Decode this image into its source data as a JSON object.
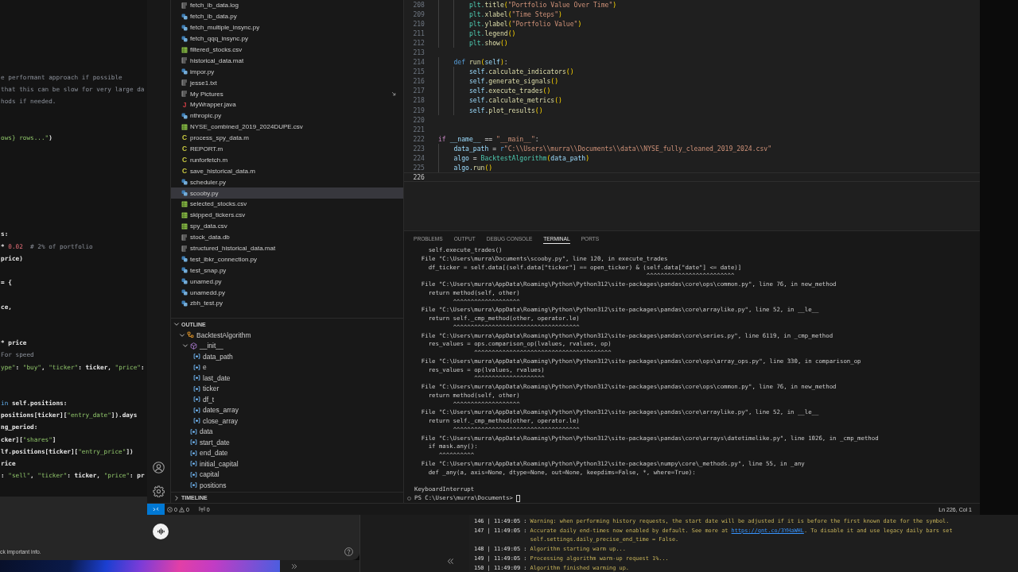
{
  "left_window": {
    "lines": [
      {
        "kind": "code",
        "tokens": [
          {
            "kind": "comment",
            "text": "e performant approach if possible"
          }
        ]
      },
      {
        "kind": "code",
        "tokens": [
          {
            "kind": "comment",
            "text": "that this can be slow for very large da"
          }
        ]
      },
      {
        "kind": "code",
        "tokens": [
          {
            "kind": "comment",
            "text": "hods if needed."
          }
        ]
      },
      {
        "kind": "blank"
      },
      {
        "kind": "blank"
      },
      {
        "kind": "code",
        "tokens": [
          {
            "kind": "string",
            "text": "ows} rows...\""
          },
          {
            "kind": "plain",
            "text": ")"
          }
        ]
      },
      {
        "kind": "blank"
      },
      {
        "kind": "blank"
      },
      {
        "kind": "blank"
      },
      {
        "kind": "blank"
      },
      {
        "kind": "blank"
      },
      {
        "kind": "blank"
      },
      {
        "kind": "blank"
      },
      {
        "kind": "code",
        "tokens": [
          {
            "kind": "plain",
            "text": "s:"
          }
        ]
      },
      {
        "kind": "code",
        "tokens": [
          {
            "kind": "plain",
            "text": "* "
          },
          {
            "kind": "number",
            "text": "0.02"
          },
          {
            "kind": "comment",
            "text": "  # 2% of portfolio"
          }
        ]
      },
      {
        "kind": "code",
        "tokens": [
          {
            "kind": "plain",
            "text": "price)"
          }
        ]
      },
      {
        "kind": "blank"
      },
      {
        "kind": "code",
        "tokens": [
          {
            "kind": "plain",
            "text": "= {"
          }
        ]
      },
      {
        "kind": "blank"
      },
      {
        "kind": "code",
        "tokens": [
          {
            "kind": "plain",
            "text": "ce,"
          }
        ]
      },
      {
        "kind": "blank"
      },
      {
        "kind": "blank"
      },
      {
        "kind": "code",
        "tokens": [
          {
            "kind": "plain",
            "text": "* price"
          }
        ]
      },
      {
        "kind": "code",
        "tokens": [
          {
            "kind": "comment",
            "text": "For speed"
          }
        ]
      },
      {
        "kind": "code",
        "tokens": [
          {
            "kind": "string",
            "text": "ype\""
          },
          {
            "kind": "plain",
            "text": ": "
          },
          {
            "kind": "string",
            "text": "\"buy\""
          },
          {
            "kind": "plain",
            "text": ", "
          },
          {
            "kind": "string",
            "text": "\"ticker\""
          },
          {
            "kind": "plain",
            "text": ": ticker, "
          },
          {
            "kind": "string",
            "text": "\"price\""
          },
          {
            "kind": "plain",
            "text": ":"
          }
        ]
      },
      {
        "kind": "blank"
      },
      {
        "kind": "blank"
      },
      {
        "kind": "code",
        "tokens": [
          {
            "kind": "keyword",
            "text": "in"
          },
          {
            "kind": "plain",
            "text": " self.positions:"
          }
        ]
      },
      {
        "kind": "code",
        "tokens": [
          {
            "kind": "plain",
            "text": "positions[ticker]["
          },
          {
            "kind": "string",
            "text": "\"entry_date\""
          },
          {
            "kind": "plain",
            "text": "]).days"
          }
        ]
      },
      {
        "kind": "code",
        "tokens": [
          {
            "kind": "plain",
            "text": "ng_period:"
          }
        ]
      },
      {
        "kind": "code",
        "tokens": [
          {
            "kind": "plain",
            "text": "cker]["
          },
          {
            "kind": "string",
            "text": "\"shares\""
          },
          {
            "kind": "plain",
            "text": "]"
          }
        ]
      },
      {
        "kind": "code",
        "tokens": [
          {
            "kind": "plain",
            "text": "lf.positions[ticker]["
          },
          {
            "kind": "string",
            "text": "\"entry_price\""
          },
          {
            "kind": "plain",
            "text": "])"
          }
        ]
      },
      {
        "kind": "code",
        "tokens": [
          {
            "kind": "plain",
            "text": "rice"
          }
        ]
      },
      {
        "kind": "code",
        "tokens": [
          {
            "kind": "plain",
            "text": ": "
          },
          {
            "kind": "string",
            "text": "\"sell\""
          },
          {
            "kind": "plain",
            "text": ", "
          },
          {
            "kind": "string",
            "text": "\"ticker\""
          },
          {
            "kind": "plain",
            "text": ": ticker, "
          },
          {
            "kind": "string",
            "text": "\"price\""
          },
          {
            "kind": "plain",
            "text": ": pr"
          }
        ]
      }
    ]
  },
  "explorer": {
    "files": [
      {
        "name": "fetch_ib_data.log",
        "kind": "text",
        "selected": false
      },
      {
        "name": "fetch_ib_data.py",
        "kind": "python",
        "selected": false
      },
      {
        "name": "fetch_multiple_insync.py",
        "kind": "python",
        "selected": false
      },
      {
        "name": "fetch_qqq_insync.py",
        "kind": "python",
        "selected": false
      },
      {
        "name": "filtered_stocks.csv",
        "kind": "csv",
        "selected": false
      },
      {
        "name": "historical_data.mat",
        "kind": "text",
        "selected": false
      },
      {
        "name": "impor.py",
        "kind": "python",
        "selected": false
      },
      {
        "name": "jesse1.txt",
        "kind": "text",
        "selected": false
      },
      {
        "name": "My Pictures",
        "kind": "symlink",
        "selected": false
      },
      {
        "name": "MyWrapper.java",
        "kind": "java",
        "glyph": "J",
        "selected": false
      },
      {
        "name": "nthropic.py",
        "kind": "python",
        "selected": false
      },
      {
        "name": "NYSE_combined_2019_2024DUPE.csv",
        "kind": "csv",
        "selected": false
      },
      {
        "name": "process_spy_data.m",
        "kind": "matlab",
        "glyph": "C",
        "selected": false
      },
      {
        "name": "REPORT.m",
        "kind": "matlab",
        "glyph": "C",
        "selected": false
      },
      {
        "name": "runforfetch.m",
        "kind": "matlab",
        "glyph": "C",
        "selected": false
      },
      {
        "name": "save_historical_data.m",
        "kind": "matlab",
        "glyph": "C",
        "selected": false
      },
      {
        "name": "scheduler.py",
        "kind": "python",
        "selected": false
      },
      {
        "name": "scooby.py",
        "kind": "python",
        "selected": true
      },
      {
        "name": "selected_stocks.csv",
        "kind": "csv",
        "selected": false
      },
      {
        "name": "skipped_tickers.csv",
        "kind": "csv",
        "selected": false
      },
      {
        "name": "spy_data.csv",
        "kind": "csv",
        "selected": false
      },
      {
        "name": "stock_data.db",
        "kind": "text",
        "selected": false
      },
      {
        "name": "structured_historical_data.mat",
        "kind": "text",
        "selected": false
      },
      {
        "name": "test_ibkr_connection.py",
        "kind": "python",
        "selected": false
      },
      {
        "name": "test_snap.py",
        "kind": "python",
        "selected": false
      },
      {
        "name": "unamed.py",
        "kind": "python",
        "selected": false
      },
      {
        "name": "unamedd.py",
        "kind": "python",
        "selected": false
      },
      {
        "name": "zbh_test.py",
        "kind": "python",
        "selected": false
      }
    ]
  },
  "outline": {
    "title": "OUTLINE",
    "expanded": true,
    "items": [
      {
        "name": "BacktestAlgorithm",
        "kind": "class",
        "expanded": true,
        "children": [
          {
            "name": "__init__",
            "kind": "method",
            "expanded": true,
            "children": [
              {
                "name": "data_path",
                "kind": "variable"
              },
              {
                "name": "e",
                "kind": "variable"
              },
              {
                "name": "last_date",
                "kind": "variable"
              },
              {
                "name": "ticker",
                "kind": "variable"
              },
              {
                "name": "df_t",
                "kind": "variable"
              },
              {
                "name": "dates_array",
                "kind": "variable"
              },
              {
                "name": "close_array",
                "kind": "variable"
              }
            ]
          },
          {
            "name": "data",
            "kind": "variable"
          },
          {
            "name": "start_date",
            "kind": "variable"
          },
          {
            "name": "end_date",
            "kind": "variable"
          },
          {
            "name": "initial_capital",
            "kind": "variable"
          },
          {
            "name": "capital",
            "kind": "variable"
          },
          {
            "name": "positions",
            "kind": "variable"
          }
        ]
      }
    ]
  },
  "timeline": {
    "title": "TIMELINE",
    "expanded": false
  },
  "editor": {
    "lines": [
      {
        "number": "208",
        "current": false,
        "tokens": [
          {
            "kind": "type",
            "text": "        plt."
          },
          {
            "kind": "function",
            "text": "title"
          },
          {
            "kind": "bracket",
            "text": "("
          },
          {
            "kind": "string",
            "text": "\"Portfolio Value Over Time\""
          },
          {
            "kind": "bracket",
            "text": ")"
          }
        ]
      },
      {
        "number": "209",
        "current": false,
        "tokens": [
          {
            "kind": "type",
            "text": "        plt."
          },
          {
            "kind": "function",
            "text": "xlabel"
          },
          {
            "kind": "bracket",
            "text": "("
          },
          {
            "kind": "string",
            "text": "\"Time Steps\""
          },
          {
            "kind": "bracket",
            "text": ")"
          }
        ]
      },
      {
        "number": "210",
        "current": false,
        "tokens": [
          {
            "kind": "type",
            "text": "        plt."
          },
          {
            "kind": "function",
            "text": "ylabel"
          },
          {
            "kind": "bracket",
            "text": "("
          },
          {
            "kind": "string",
            "text": "\"Portfolio Value\""
          },
          {
            "kind": "bracket",
            "text": ")"
          }
        ]
      },
      {
        "number": "211",
        "current": false,
        "tokens": [
          {
            "kind": "type",
            "text": "        plt."
          },
          {
            "kind": "function",
            "text": "legend"
          },
          {
            "kind": "bracket",
            "text": "()"
          }
        ]
      },
      {
        "number": "212",
        "current": false,
        "tokens": [
          {
            "kind": "type",
            "text": "        plt."
          },
          {
            "kind": "function",
            "text": "show"
          },
          {
            "kind": "bracket",
            "text": "()"
          }
        ]
      },
      {
        "number": "213",
        "current": false
      },
      {
        "number": "214",
        "current": false,
        "tokens": [
          {
            "kind": "keyword",
            "text": "    def "
          },
          {
            "kind": "function",
            "text": "run"
          },
          {
            "kind": "bracket",
            "text": "("
          },
          {
            "kind": "variable",
            "text": "self"
          },
          {
            "kind": "bracket",
            "text": ")"
          },
          {
            "kind": "plain",
            "text": ":"
          }
        ]
      },
      {
        "number": "215",
        "current": false,
        "tokens": [
          {
            "kind": "variable",
            "text": "        self."
          },
          {
            "kind": "function",
            "text": "calculate_indicators"
          },
          {
            "kind": "bracket",
            "text": "()"
          }
        ]
      },
      {
        "number": "216",
        "current": false,
        "tokens": [
          {
            "kind": "variable",
            "text": "        self."
          },
          {
            "kind": "function",
            "text": "generate_signals"
          },
          {
            "kind": "bracket",
            "text": "()"
          }
        ]
      },
      {
        "number": "217",
        "current": false,
        "tokens": [
          {
            "kind": "variable",
            "text": "        self."
          },
          {
            "kind": "function",
            "text": "execute_trades"
          },
          {
            "kind": "bracket",
            "text": "()"
          }
        ]
      },
      {
        "number": "218",
        "current": false,
        "tokens": [
          {
            "kind": "variable",
            "text": "        self."
          },
          {
            "kind": "function",
            "text": "calculate_metrics"
          },
          {
            "kind": "bracket",
            "text": "()"
          }
        ]
      },
      {
        "number": "219",
        "current": false,
        "tokens": [
          {
            "kind": "variable",
            "text": "        self."
          },
          {
            "kind": "function",
            "text": "plot_results"
          },
          {
            "kind": "bracket",
            "text": "()"
          }
        ]
      },
      {
        "number": "220",
        "current": false
      },
      {
        "number": "221",
        "current": false
      },
      {
        "number": "222",
        "current": false,
        "tokens": [
          {
            "kind": "control",
            "text": "if "
          },
          {
            "kind": "variable",
            "text": "__name__"
          },
          {
            "kind": "plain",
            "text": " == "
          },
          {
            "kind": "string",
            "text": "\"__main__\""
          },
          {
            "kind": "plain",
            "text": ":"
          }
        ]
      },
      {
        "number": "223",
        "current": false,
        "tokens": [
          {
            "kind": "variable",
            "text": "    data_path"
          },
          {
            "kind": "plain",
            "text": " = "
          },
          {
            "kind": "keyword",
            "text": "r"
          },
          {
            "kind": "string",
            "text": "\"C:\\\\Users\\\\murra\\\\Documents\\\\data\\\\NYSE_fully_cleaned_2019_2024.csv\""
          }
        ]
      },
      {
        "number": "224",
        "current": false,
        "tokens": [
          {
            "kind": "variable",
            "text": "    algo"
          },
          {
            "kind": "plain",
            "text": " = "
          },
          {
            "kind": "type",
            "text": "BacktestAlgorithm"
          },
          {
            "kind": "bracket",
            "text": "("
          },
          {
            "kind": "variable",
            "text": "data_path"
          },
          {
            "kind": "bracket",
            "text": ")"
          }
        ]
      },
      {
        "number": "225",
        "current": false,
        "tokens": [
          {
            "kind": "variable",
            "text": "    algo."
          },
          {
            "kind": "function",
            "text": "run"
          },
          {
            "kind": "bracket",
            "text": "()"
          }
        ]
      },
      {
        "number": "226",
        "current": true
      }
    ]
  },
  "panel": {
    "tabs": [
      {
        "label": "PROBLEMS",
        "selected": false
      },
      {
        "label": "OUTPUT",
        "selected": false
      },
      {
        "label": "DEBUG CONSOLE",
        "selected": false
      },
      {
        "label": "TERMINAL",
        "selected": true
      },
      {
        "label": "PORTS",
        "selected": false
      }
    ],
    "terminal": {
      "lines": [
        {
          "kind": "text",
          "text": "    self.execute_trades()"
        },
        {
          "kind": "text",
          "text": "  File \"C:\\Users\\murra\\Documents\\scooby.py\", line 120, in execute_trades"
        },
        {
          "kind": "text",
          "text": "    df_ticker = self.data[(self.data[\"ticker\"] == open_ticker) & (self.data[\"date\"] <= date)]"
        },
        {
          "kind": "text",
          "text": "                                                                  ^^^^^^^^^^^^^^^^^^^^^^^^^"
        },
        {
          "kind": "text",
          "text": "  File \"C:\\Users\\murra\\AppData\\Roaming\\Python\\Python312\\site-packages\\pandas\\core\\ops\\common.py\", line 76, in new_method"
        },
        {
          "kind": "text",
          "text": "    return method(self, other)"
        },
        {
          "kind": "text",
          "text": "           ^^^^^^^^^^^^^^^^^^^"
        },
        {
          "kind": "text",
          "text": "  File \"C:\\Users\\murra\\AppData\\Roaming\\Python\\Python312\\site-packages\\pandas\\core\\arraylike.py\", line 52, in __le__"
        },
        {
          "kind": "text",
          "text": "    return self._cmp_method(other, operator.le)"
        },
        {
          "kind": "text",
          "text": "           ^^^^^^^^^^^^^^^^^^^^^^^^^^^^^^^^^^^^"
        },
        {
          "kind": "text",
          "text": "  File \"C:\\Users\\murra\\AppData\\Roaming\\Python\\Python312\\site-packages\\pandas\\core\\series.py\", line 6119, in _cmp_method"
        },
        {
          "kind": "text",
          "text": "    res_values = ops.comparison_op(lvalues, rvalues, op)"
        },
        {
          "kind": "text",
          "text": "                 ^^^^^^^^^^^^^^^^^^^^^^^^^^^^^^^^^^^^^^^"
        },
        {
          "kind": "text",
          "text": "  File \"C:\\Users\\murra\\AppData\\Roaming\\Python\\Python312\\site-packages\\pandas\\core\\ops\\array_ops.py\", line 330, in comparison_op"
        },
        {
          "kind": "text",
          "text": "    res_values = op(lvalues, rvalues)"
        },
        {
          "kind": "text",
          "text": "                 ^^^^^^^^^^^^^^^^^^^^"
        },
        {
          "kind": "text",
          "text": "  File \"C:\\Users\\murra\\AppData\\Roaming\\Python\\Python312\\site-packages\\pandas\\core\\ops\\common.py\", line 76, in new_method"
        },
        {
          "kind": "text",
          "text": "    return method(self, other)"
        },
        {
          "kind": "text",
          "text": "           ^^^^^^^^^^^^^^^^^^^"
        },
        {
          "kind": "text",
          "text": "  File \"C:\\Users\\murra\\AppData\\Roaming\\Python\\Python312\\site-packages\\pandas\\core\\arraylike.py\", line 52, in __le__"
        },
        {
          "kind": "text",
          "text": "    return self._cmp_method(other, operator.le)"
        },
        {
          "kind": "text",
          "text": "           ^^^^^^^^^^^^^^^^^^^^^^^^^^^^^^^^^^^^"
        },
        {
          "kind": "text",
          "text": "  File \"C:\\Users\\murra\\AppData\\Roaming\\Python\\Python312\\site-packages\\pandas\\core\\arrays\\datetimelike.py\", line 1026, in _cmp_method"
        },
        {
          "kind": "text",
          "text": "    if mask.any():"
        },
        {
          "kind": "text",
          "text": "       ^^^^^^^^^^"
        },
        {
          "kind": "text",
          "text": "  File \"C:\\Users\\murra\\AppData\\Roaming\\Python\\Python312\\site-packages\\numpy\\core\\_methods.py\", line 55, in _any"
        },
        {
          "kind": "text",
          "text": "    def _any(a, axis=None, dtype=None, out=None, keepdims=False, *, where=True):"
        },
        {
          "kind": "blank"
        },
        {
          "kind": "text",
          "text": "KeyboardInterrupt"
        },
        {
          "kind": "prompt",
          "text": "PS C:\\Users\\murra\\Documents>"
        }
      ]
    }
  },
  "status_bar": {
    "problems": [
      {
        "kind": "error",
        "count": "0"
      },
      {
        "kind": "warning",
        "count": "0"
      }
    ],
    "ports": "0",
    "cursor": "Ln 226, Col 1"
  },
  "log_window": {
    "lines": [
      {
        "prefix": "146 | 11:49:05 :",
        "message": [
          {
            "kind": "text",
            "text": "Warning: when performing history requests, the start date will be adjusted if it is before the first known date for the symbol."
          }
        ]
      },
      {
        "prefix": "147 | 11:49:05 :",
        "message": [
          {
            "kind": "text",
            "text": "Accurate daily end-times now enabled by default. See more at "
          },
          {
            "kind": "link",
            "text": "https://qnt.co/3YHaWHL"
          },
          {
            "kind": "text",
            "text": ". To disable it and use legacy daily bars set self.settings.daily_precise_end_time = False."
          }
        ]
      },
      {
        "prefix": "148 | 11:49:05 :",
        "message": [
          {
            "kind": "text",
            "text": "Algorithm starting warm up..."
          }
        ]
      },
      {
        "prefix": "149 | 11:49:05 :",
        "message": [
          {
            "kind": "text",
            "text": "Processing algorithm warm-up request 1%..."
          }
        ]
      },
      {
        "prefix": "150 | 11:49:09 :",
        "message": [
          {
            "kind": "text",
            "text": "Algorithm finished warming up."
          }
        ]
      }
    ]
  },
  "chat": {
    "notice": "ck important info."
  }
}
